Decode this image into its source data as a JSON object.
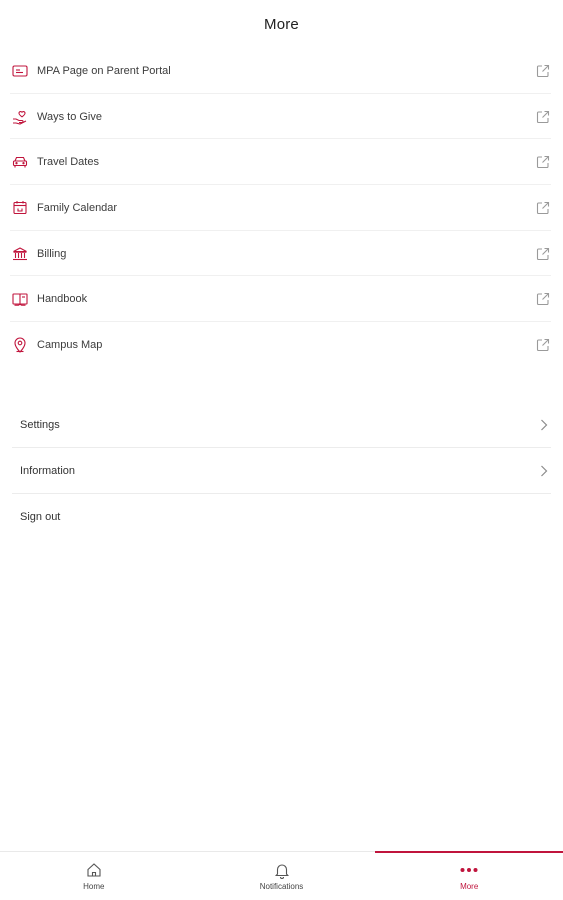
{
  "header": {
    "title": "More"
  },
  "colors": {
    "accent": "#c0143c",
    "divider": "#f0f0f0"
  },
  "links": [
    {
      "label": "MPA Page on Parent Portal",
      "icon": "id-card-icon"
    },
    {
      "label": "Ways to Give",
      "icon": "heart-hands-icon"
    },
    {
      "label": "Travel Dates",
      "icon": "car-icon"
    },
    {
      "label": "Family Calendar",
      "icon": "calendar-icon"
    },
    {
      "label": "Billing",
      "icon": "bank-icon"
    },
    {
      "label": "Handbook",
      "icon": "book-icon"
    },
    {
      "label": "Campus Map",
      "icon": "map-pin-icon"
    }
  ],
  "settings": {
    "items": [
      {
        "label": "Settings"
      },
      {
        "label": "Information"
      },
      {
        "label": "Sign out"
      }
    ]
  },
  "tabbar": {
    "tabs": [
      {
        "label": "Home",
        "icon": "home-icon"
      },
      {
        "label": "Notifications",
        "icon": "bell-icon"
      },
      {
        "label": "More",
        "icon": "more-dots-icon",
        "active": true
      }
    ]
  }
}
